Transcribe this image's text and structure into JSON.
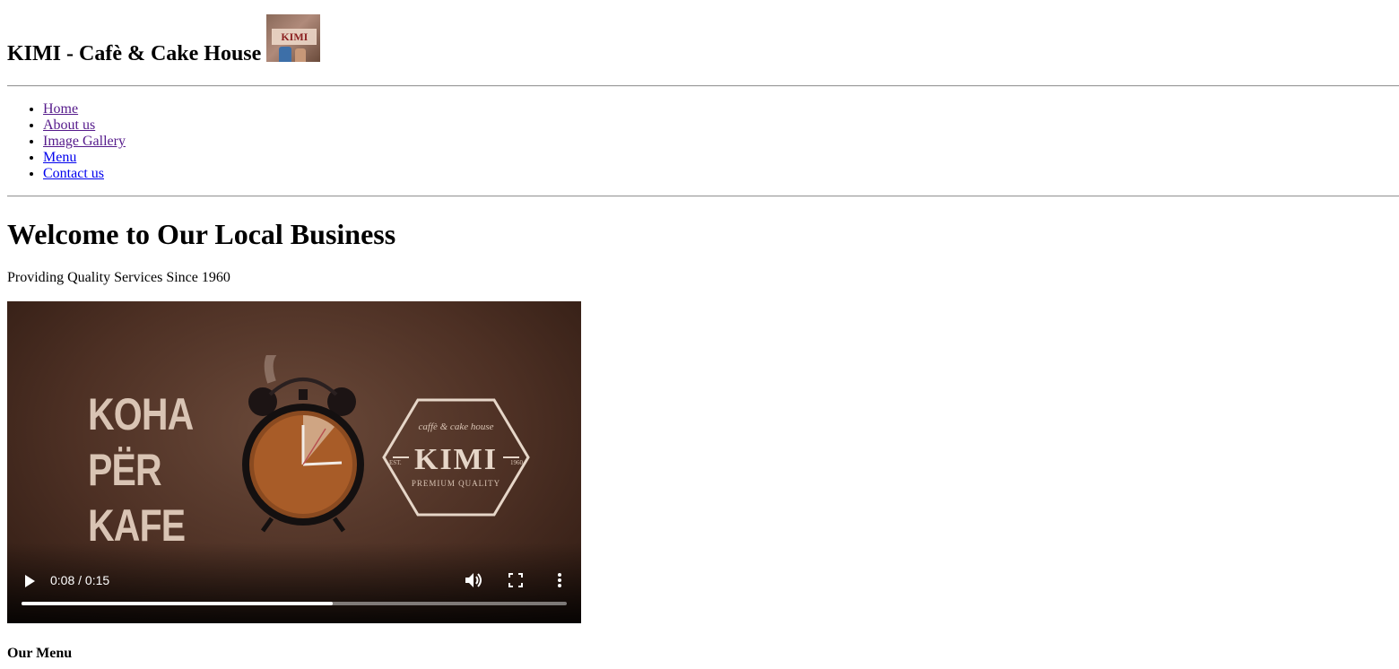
{
  "header": {
    "title": "KIMI - Cafè & Cake House",
    "logo_text": "KIMI"
  },
  "nav": {
    "items": [
      {
        "label": "Home",
        "visited": true
      },
      {
        "label": "About us",
        "visited": true
      },
      {
        "label": "Image Gallery",
        "visited": true
      },
      {
        "label": "Menu",
        "visited": false
      },
      {
        "label": "Contact us",
        "visited": false
      }
    ]
  },
  "main": {
    "heading": "Welcome to Our Local Business",
    "tagline": "Providing Quality Services Since 1960",
    "menu_heading": "Our Menu"
  },
  "video": {
    "overlay_words": [
      "KOHA",
      "PËR",
      "KAFE"
    ],
    "badge": {
      "top": "caffè & cake house",
      "title": "KIMI",
      "est": "EST.",
      "year": "1960",
      "bottom": "PREMIUM QUALITY"
    },
    "time_display": "0:08 / 0:15",
    "current_seconds": 8,
    "duration_seconds": 15,
    "played_fraction": 0.57,
    "icons": {
      "play": "play-icon",
      "volume": "volume-icon",
      "fullscreen": "fullscreen-icon",
      "more": "more-vertical-icon"
    }
  },
  "colors": {
    "link": "#0000ee",
    "visited_link": "#551a8b",
    "video_bg": "#4d3024",
    "rule": "#9a9a9a"
  }
}
